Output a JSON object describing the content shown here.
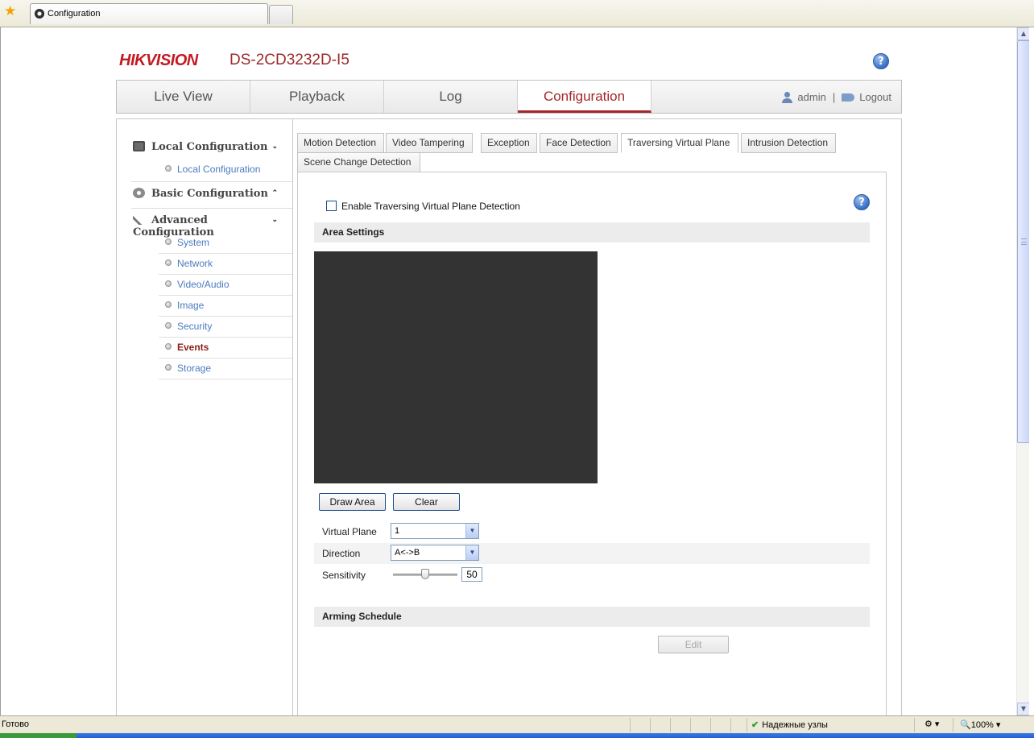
{
  "browser": {
    "tab_title": "Configuration",
    "status_text": "Готово",
    "zone_text": "Надежные узлы",
    "zoom": "100%"
  },
  "header": {
    "logo": "HIKVISION",
    "model": "DS-2CD3232D-I5",
    "help": "?"
  },
  "mainnav": {
    "tabs": [
      {
        "label": "Live View"
      },
      {
        "label": "Playback"
      },
      {
        "label": "Log"
      },
      {
        "label": "Configuration"
      }
    ],
    "user": "admin",
    "separator": "|",
    "logout": "Logout"
  },
  "sidebar": {
    "sections": [
      {
        "title": "Local Configuration",
        "chevron": "⌄"
      },
      {
        "title": "Basic Configuration",
        "chevron": "⌃"
      },
      {
        "title": "Advanced Configuration",
        "chevron": "⌄"
      }
    ],
    "local_items": [
      {
        "label": "Local Configuration"
      }
    ],
    "advanced_items": [
      {
        "label": "System"
      },
      {
        "label": "Network"
      },
      {
        "label": "Video/Audio"
      },
      {
        "label": "Image"
      },
      {
        "label": "Security"
      },
      {
        "label": "Events"
      },
      {
        "label": "Storage"
      }
    ],
    "active_item": "Events"
  },
  "subtabs": [
    {
      "label": "Motion Detection"
    },
    {
      "label": "Video Tampering"
    },
    {
      "label": "Exception"
    },
    {
      "label": "Face Detection"
    },
    {
      "label": "Traversing Virtual Plane"
    },
    {
      "label": "Intrusion Detection"
    },
    {
      "label": "Scene Change Detection"
    }
  ],
  "active_subtab": "Traversing Virtual Plane",
  "main": {
    "enable_label": "Enable Traversing Virtual Plane Detection",
    "enable_checked": false,
    "area_settings_title": "Area Settings",
    "draw_area_button": "Draw Area",
    "clear_button": "Clear",
    "virtual_plane_label": "Virtual Plane",
    "virtual_plane_value": "1",
    "direction_label": "Direction",
    "direction_value": "A<->B",
    "sensitivity_label": "Sensitivity",
    "sensitivity_value": "50",
    "arming_schedule_title": "Arming Schedule",
    "edit_button": "Edit"
  },
  "colors": {
    "brand_red": "#c21b22",
    "active_tab": "#a6262a",
    "link_blue": "#4a7cbd",
    "video_bg": "#333333"
  }
}
